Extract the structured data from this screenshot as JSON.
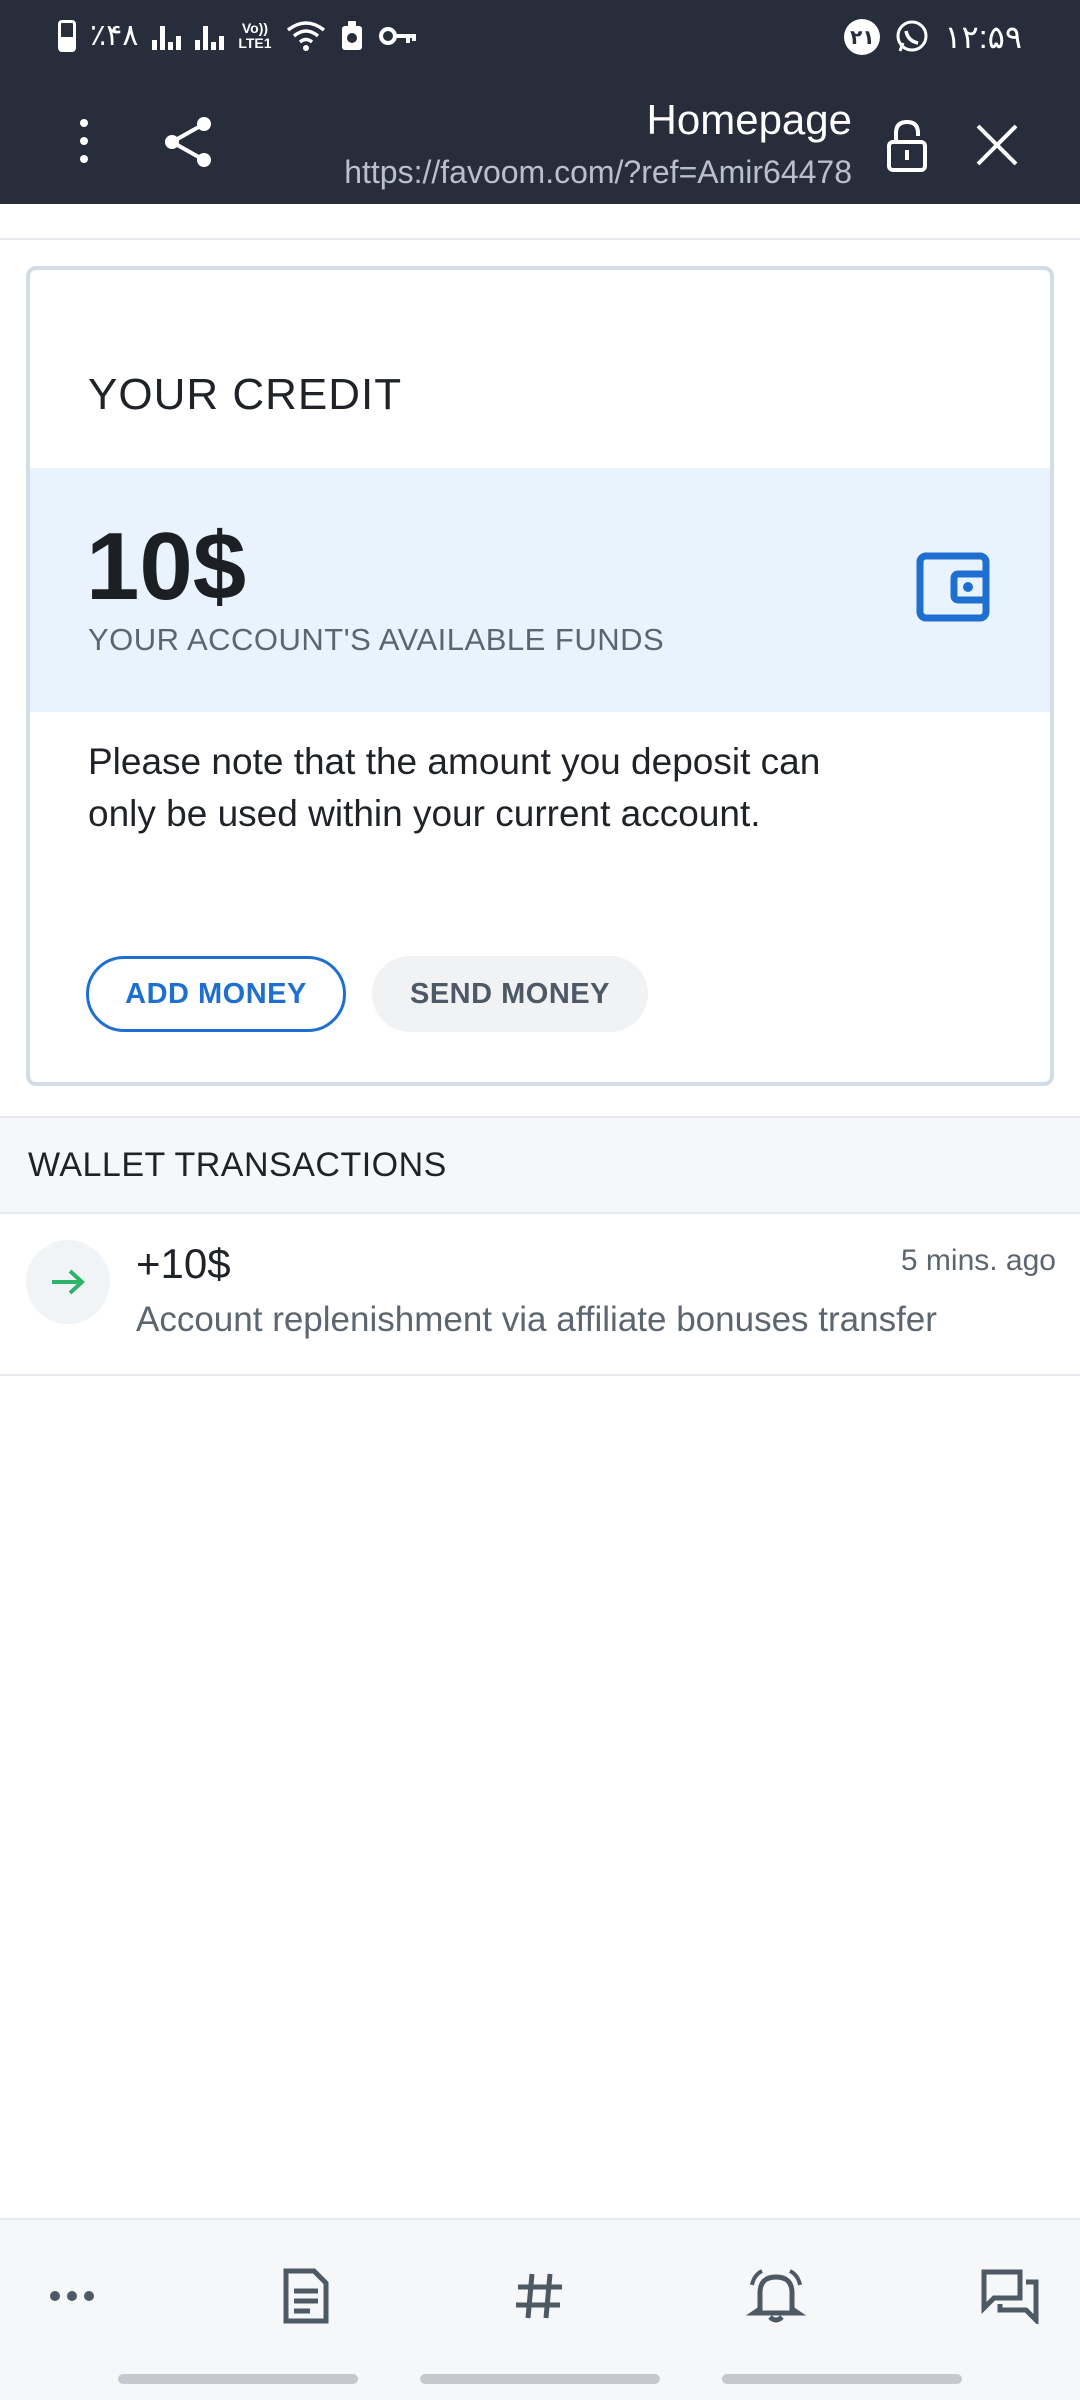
{
  "status_bar": {
    "battery_text": "٪۴۸",
    "lte_top": "Vo))",
    "lte_bottom": "LTE1",
    "notif_badge": "۲۱",
    "time": "۱۲:۵۹"
  },
  "browser": {
    "page_title": "Homepage",
    "url": "https://favoom.com/?ref=Amir64478"
  },
  "credit": {
    "title": "YOUR CREDIT",
    "amount": "10$",
    "amount_label": "YOUR ACCOUNT'S AVAILABLE FUNDS",
    "note": "Please note that the amount you deposit can only be used within your current account.",
    "add_money_label": "ADD MONEY",
    "send_money_label": "SEND MONEY"
  },
  "transactions": {
    "header": "WALLET TRANSACTIONS",
    "items": [
      {
        "amount": "+10$",
        "time": "5 mins. ago",
        "description": "Account replenishment via affiliate bonuses transfer",
        "direction_icon": "arrow-right-icon"
      }
    ]
  },
  "bottom_nav": {
    "items": [
      "more-icon",
      "document-icon",
      "hashtag-icon",
      "bell-icon",
      "chat-icon"
    ]
  },
  "colors": {
    "header_bg": "#272d3b",
    "accent_blue": "#1e6fd0",
    "band_bg": "#e9f3fd",
    "incoming_green": "#2fb36a"
  }
}
